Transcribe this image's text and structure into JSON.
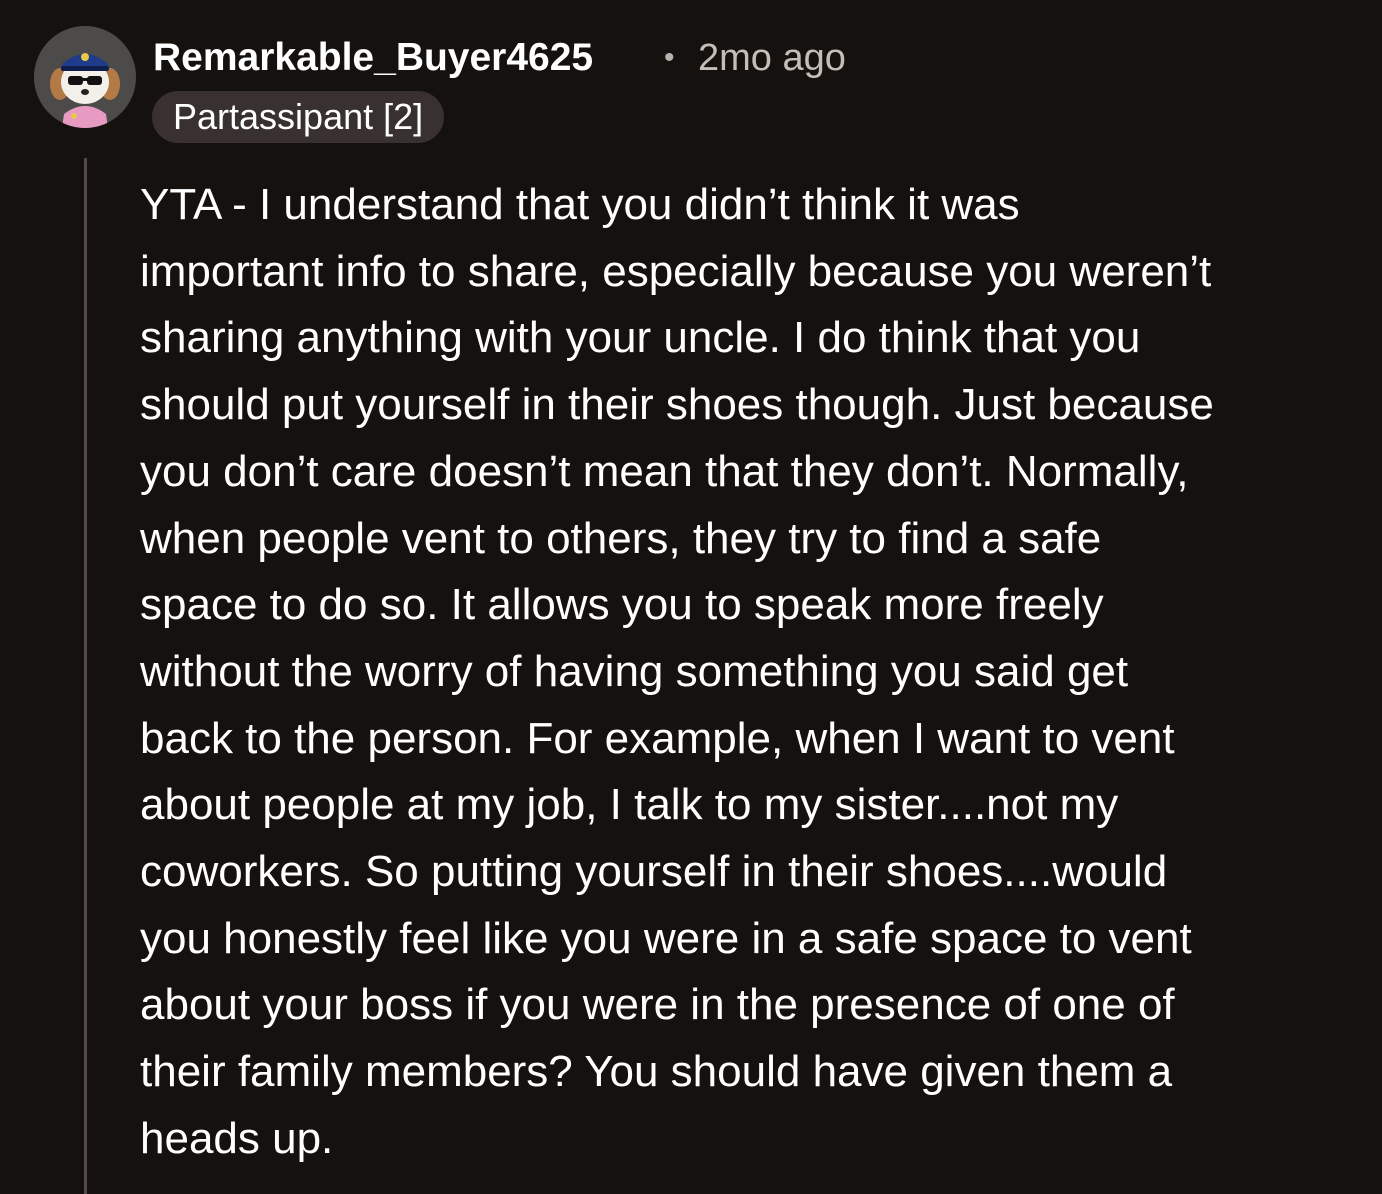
{
  "comment": {
    "avatar_icon": "reddit-snoo-avatar-icon",
    "author": "Remarkable_Buyer4625",
    "separator": "•",
    "timestamp": "2mo ago",
    "flair": "Partassipant [2]",
    "body_lines": [
      "YTA - I understand that you didn’t think it was",
      "important info to share, especially because you weren’t",
      "sharing anything with your uncle. I do think that you",
      "should put yourself in their shoes though. Just because",
      "you don’t care doesn’t mean that they don’t. Normally,",
      "when people vent to others, they try to find a safe",
      "space to do so. It allows you to speak more freely",
      "without the worry of having something you said get",
      "back to the person. For example, when I want to vent",
      "about people at my job, I talk to my sister....not my",
      "coworkers. So putting yourself in their shoes....would",
      "you honestly feel like you were in a safe space to vent",
      "about your boss if you were in the presence of one of",
      "their family members? You should have given them a",
      "heads up."
    ]
  },
  "colors": {
    "background": "#15110f",
    "text": "#ffffff",
    "muted_text": "#c4bdb8",
    "flair_bg": "#393130",
    "thread_line": "#514c49"
  }
}
